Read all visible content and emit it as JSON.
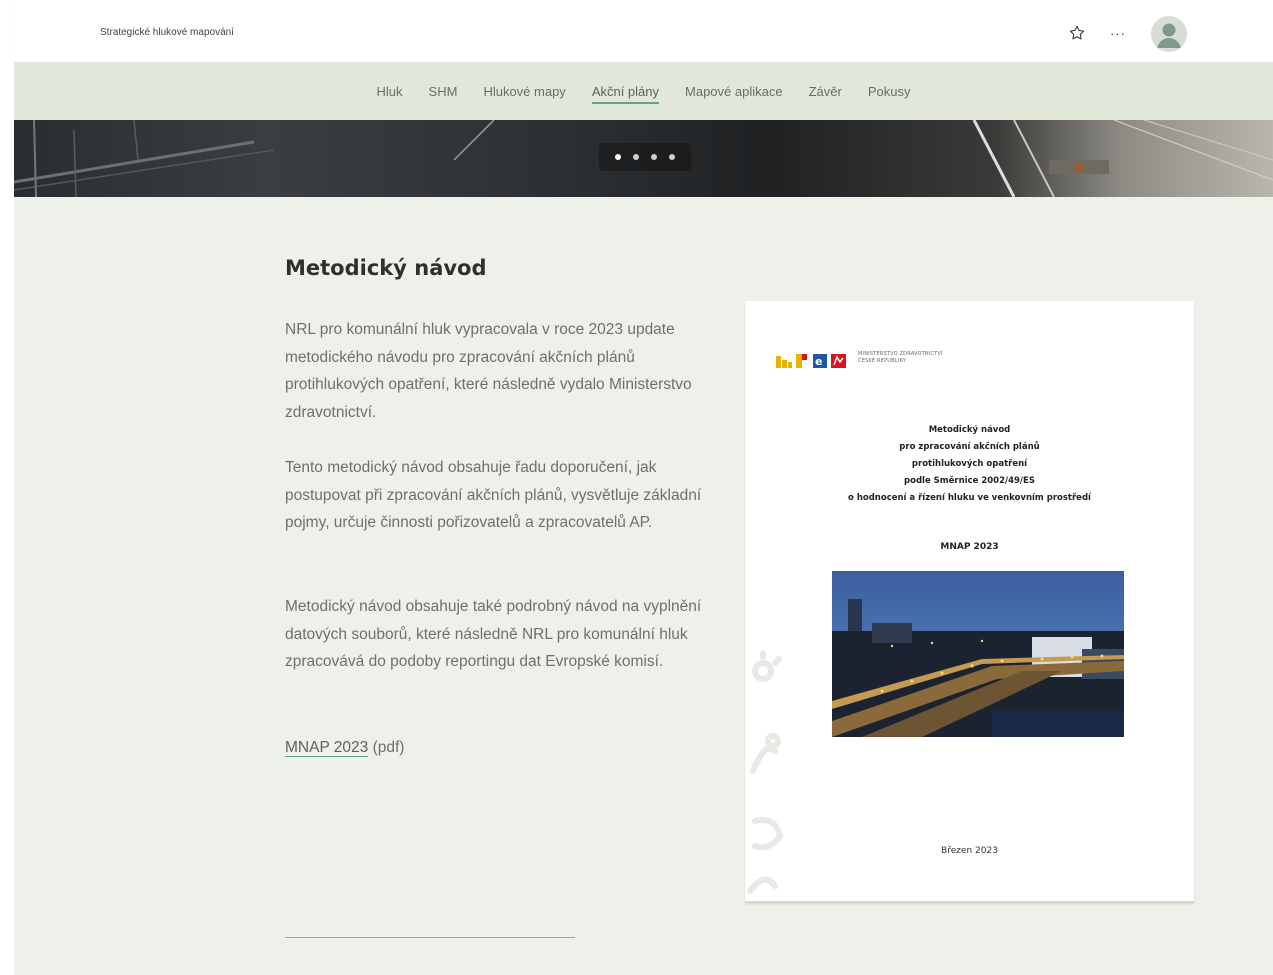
{
  "header": {
    "site_title": "Strategické hlukové mapování",
    "icons": [
      "star-icon",
      "more-icon",
      "avatar-icon"
    ],
    "more_label": "···"
  },
  "nav": {
    "items": [
      {
        "label": "Hluk"
      },
      {
        "label": "SHM"
      },
      {
        "label": "Hlukové mapy"
      },
      {
        "label": "Akční plány",
        "active": true
      },
      {
        "label": "Mapové aplikace"
      },
      {
        "label": "Závěr"
      },
      {
        "label": "Pokusy"
      }
    ]
  },
  "hero": {
    "slide_count": 4,
    "active_slide": 1
  },
  "content": {
    "heading": "Metodický návod",
    "paragraphs": [
      "NRL pro komunální hluk vypracovala v roce 2023 update metodického návodu pro zpracování akčních plánů protihlukových opatření, které následně vydalo Ministerstvo zdravotnictví.",
      "Tento metodický návod obsahuje řadu doporučení, jak postupovat při zpracování akčních plánů, vysvětluje základní pojmy, určuje činnosti pořizovatelů a zpracovatelů AP.",
      "Metodický návod obsahuje také podrobný návod na vyplnění datových souborů, které následně NRL pro komunální hluk zpracovává do podoby reportingu dat Evropské komisí."
    ],
    "pdf_link": "MNAP 2023",
    "pdf_suffix": " (pdf)"
  },
  "document": {
    "ministry_line1": "MINISTERSTVO ZDRAVOTNICTVÍ",
    "ministry_line2": "ČESKÉ REPUBLIKY",
    "title_lines": [
      "Metodický návod",
      "pro zpracování akčních plánů",
      "protihlukových opatření",
      "podle Směrnice 2002/49/ES",
      "o hodnocení a řízení hluku ve venkovním prostředí"
    ],
    "code": "MNAP 2023",
    "date": "Březen 2023"
  },
  "colors": {
    "page_bg": "#eef1ea",
    "nav_bg": "#e1e8da",
    "accent": "#5ca786"
  }
}
